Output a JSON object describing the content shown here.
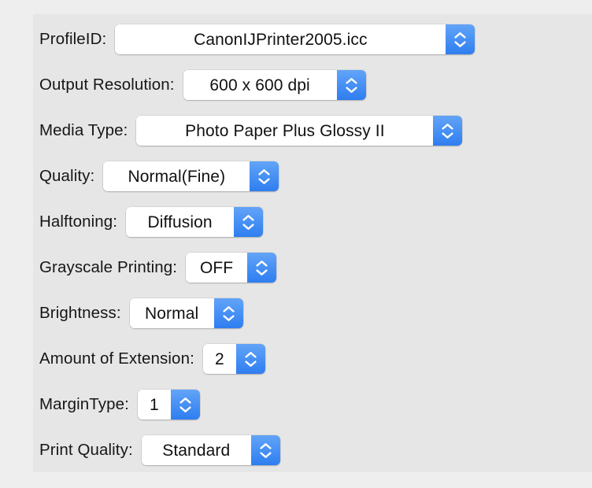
{
  "window": {
    "title": "Printer Profile Settings",
    "panel_bg": "#e6e6e6",
    "outer_bg": "#eeeeee",
    "accent": "#3b86f2",
    "label_color": "#161616"
  },
  "icons": {
    "stepper_up": "chevron-up-icon",
    "stepper_down": "chevron-down-icon"
  },
  "settings": [
    {
      "key": "profile-id",
      "label": "ProfileID:",
      "value": "CanonIJPrinter2005.icc",
      "numeric": false,
      "field_width": 420
    },
    {
      "key": "output-resolution",
      "label": "Output Resolution:",
      "value": "600 x 600 dpi",
      "numeric": false,
      "field_width": 195
    },
    {
      "key": "media-type",
      "label": "Media Type:",
      "value": "Photo Paper Plus Glossy II",
      "numeric": false,
      "field_width": 377
    },
    {
      "key": "quality",
      "label": "Quality:",
      "value": "Normal(Fine)",
      "numeric": false,
      "field_width": 186
    },
    {
      "key": "halftoning",
      "label": "Halftoning:",
      "value": "Diffusion",
      "numeric": false,
      "field_width": 137
    },
    {
      "key": "grayscale-printing",
      "label": "Grayscale Printing:",
      "value": "OFF",
      "numeric": false,
      "field_width": 78
    },
    {
      "key": "brightness",
      "label": "Brightness:",
      "value": "Normal",
      "numeric": false,
      "field_width": 107
    },
    {
      "key": "amount-of-extension",
      "label": "Amount of Extension:",
      "value": "2",
      "numeric": true,
      "field_width": 42
    },
    {
      "key": "margin-type",
      "label": "MarginType:",
      "value": "1",
      "numeric": true,
      "field_width": 42
    },
    {
      "key": "print-quality",
      "label": "Print Quality:",
      "value": "Standard",
      "numeric": false,
      "field_width": 139
    }
  ]
}
